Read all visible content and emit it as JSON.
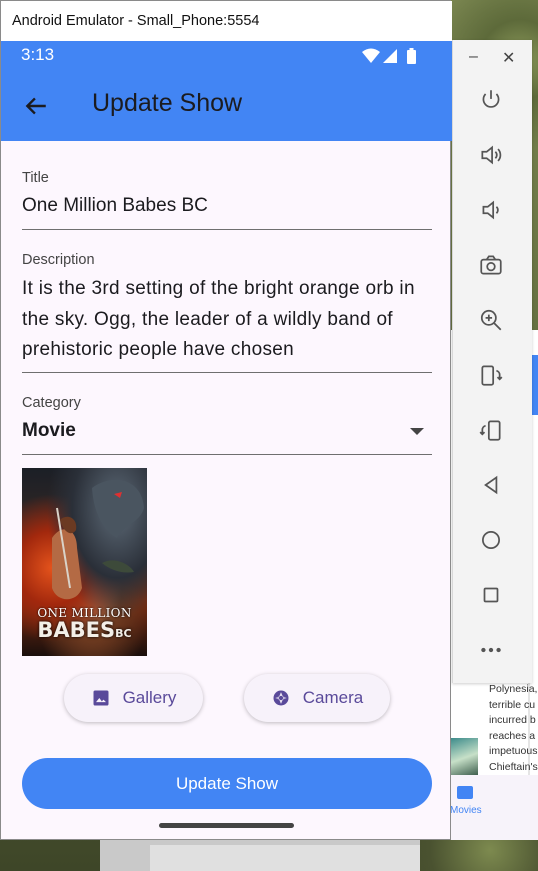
{
  "window": {
    "title": "Android Emulator - Small_Phone:5554"
  },
  "status_bar": {
    "time": "3:13"
  },
  "app_bar": {
    "title": "Update Show"
  },
  "form": {
    "title_label": "Title",
    "title_value": "One Million Babes BC",
    "description_label": "Description",
    "description_value": "It is the 3rd setting of the bright orange orb in the sky. Ogg, the leader of a wildly band of prehistoric people have chosen",
    "category_label": "Category",
    "category_value": "Movie"
  },
  "poster": {
    "line1": "ONE MILLION",
    "line2": "BABES",
    "line2_suffix": "BC"
  },
  "buttons": {
    "gallery": "Gallery",
    "camera": "Camera",
    "update": "Update Show"
  },
  "toolbar": {
    "minimize": "–",
    "close": "✕",
    "icons": [
      "power-icon",
      "volume-up-icon",
      "volume-down-icon",
      "camera-icon",
      "zoom-icon",
      "rotate-left-icon",
      "rotate-right-icon",
      "back-icon",
      "home-icon",
      "overview-icon",
      "more-icon"
    ]
  },
  "background_app": {
    "description_lines": [
      "Polynesia,",
      "terrible cu",
      "incurred b",
      "reaches a",
      "impetuous",
      "Chieftain's"
    ],
    "nav_label": "Movies"
  },
  "colors": {
    "primary": "#4285f4",
    "button_text": "#5a4a9a",
    "surface": "#fdf7fe"
  }
}
